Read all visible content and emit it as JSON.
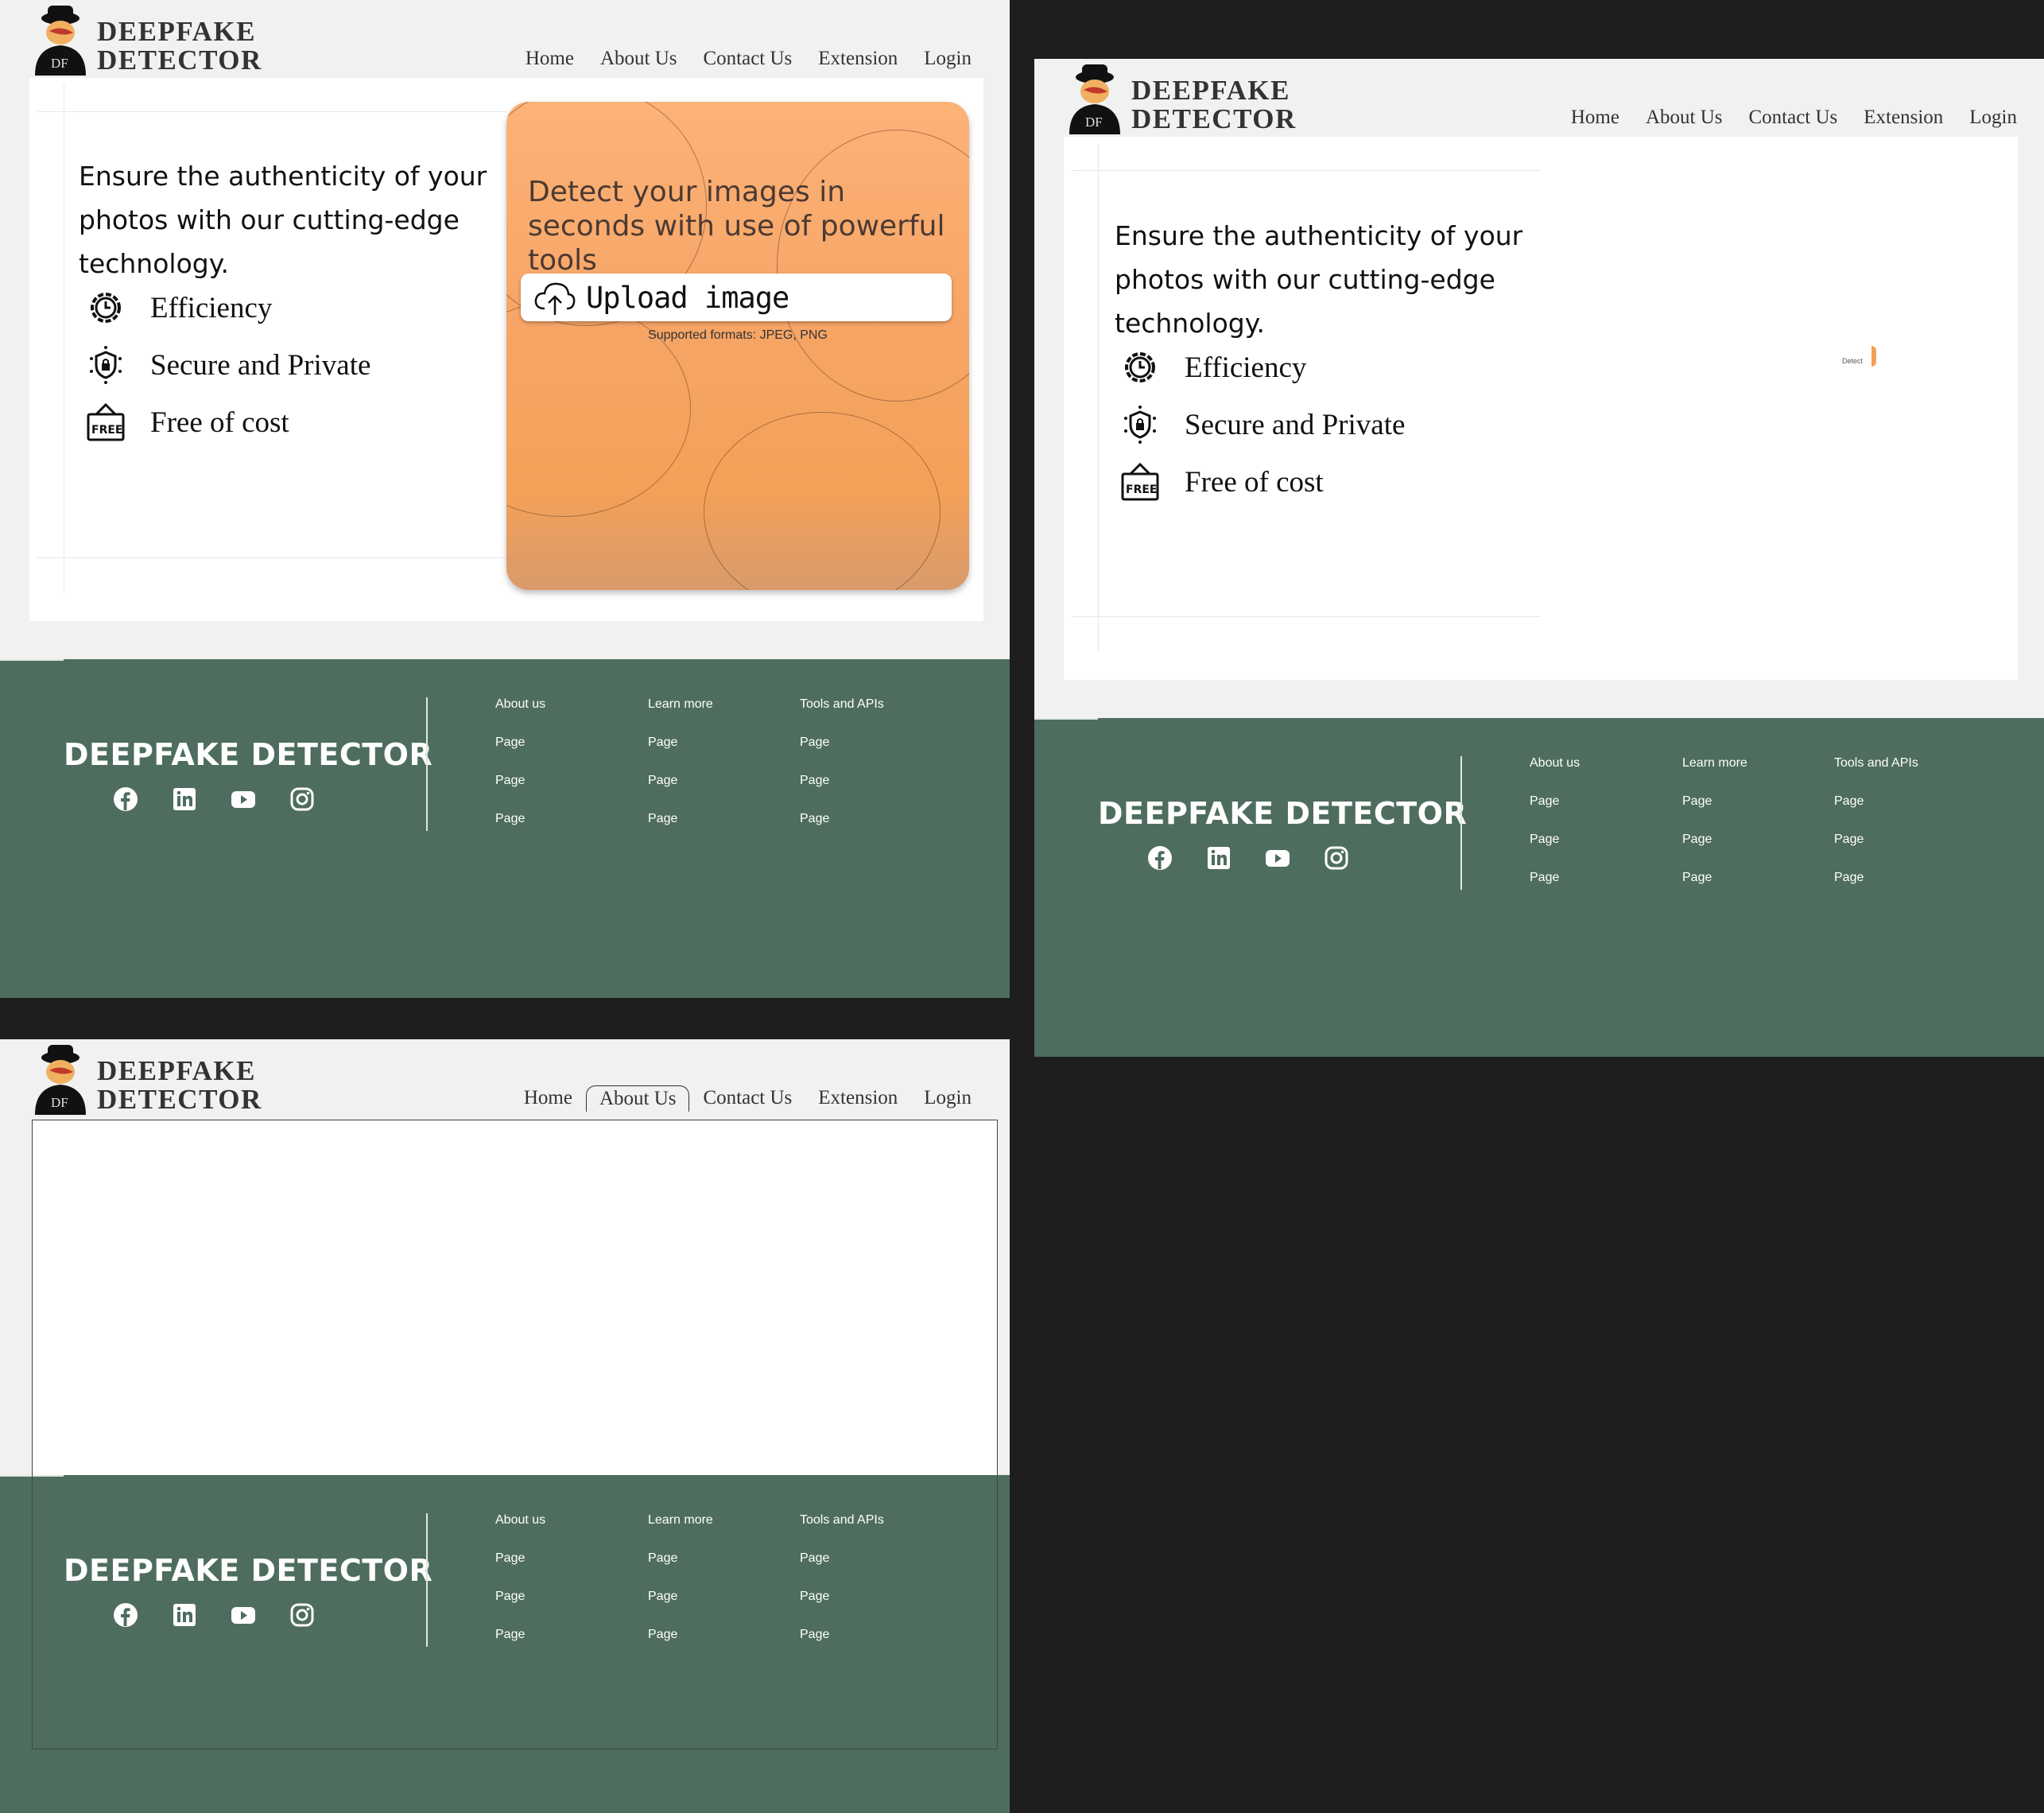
{
  "brand": {
    "line1": "DEEPFAKE",
    "line2": "DETECTOR",
    "logo_letters": "DF"
  },
  "nav": {
    "home": "Home",
    "about": "About Us",
    "contact": "Contact Us",
    "extension": "Extension",
    "login": "Login",
    "active_in_third_view": "About Us"
  },
  "hero": {
    "intro": "Ensure the authenticity of your photos with our cutting-edge technology.",
    "features": [
      {
        "icon": "gear-clock-icon",
        "label": "Efficiency"
      },
      {
        "icon": "shield-lock-icon",
        "label": "Secure and Private"
      },
      {
        "icon": "free-tag-icon",
        "label": "Free of cost"
      }
    ]
  },
  "upload": {
    "title": "Detect your images in seconds with use of powerful tools",
    "button_label": "Upload image",
    "formats": "Supported formats: JPEG, PNG",
    "mini_detect_label": "Detect"
  },
  "footer": {
    "brand": "DEEPFAKE DETECTOR",
    "socials": [
      "facebook-icon",
      "linkedin-icon",
      "youtube-icon",
      "instagram-icon"
    ],
    "columns": [
      {
        "heading": "About us",
        "links": [
          "Page",
          "Page",
          "Page"
        ]
      },
      {
        "heading": "Learn more",
        "links": [
          "Page",
          "Page",
          "Page"
        ]
      },
      {
        "heading": "Tools and APIs",
        "links": [
          "Page",
          "Page",
          "Page"
        ]
      }
    ]
  },
  "colors": {
    "footer_bg": "#4e6d5e",
    "accent_orange": "#f6a566",
    "page_bg": "#f1f1f1",
    "canvas_bg": "#1e1e1e"
  }
}
